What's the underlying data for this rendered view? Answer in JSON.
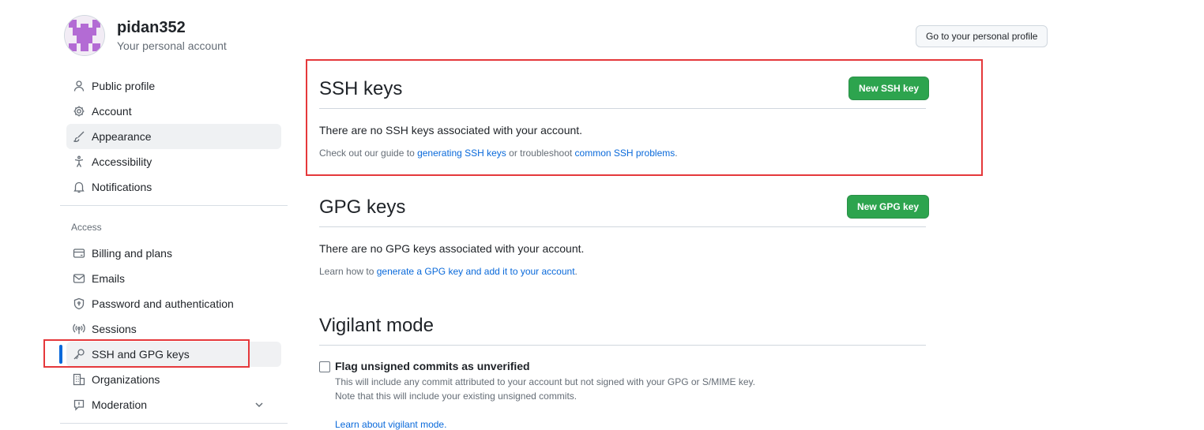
{
  "user": {
    "name": "pidan352",
    "subtitle": "Your personal account"
  },
  "header": {
    "profile_button": "Go to your personal profile"
  },
  "sidebar": {
    "items": [
      {
        "label": "Public profile",
        "icon": "person-icon"
      },
      {
        "label": "Account",
        "icon": "gear-icon"
      },
      {
        "label": "Appearance",
        "icon": "paintbrush-icon"
      },
      {
        "label": "Accessibility",
        "icon": "accessibility-icon"
      },
      {
        "label": "Notifications",
        "icon": "bell-icon"
      }
    ],
    "access_label": "Access",
    "access_items": [
      {
        "label": "Billing and plans",
        "icon": "credit-card-icon"
      },
      {
        "label": "Emails",
        "icon": "mail-icon"
      },
      {
        "label": "Password and authentication",
        "icon": "shield-lock-icon"
      },
      {
        "label": "Sessions",
        "icon": "broadcast-icon"
      },
      {
        "label": "SSH and GPG keys",
        "icon": "key-icon",
        "selected": true
      },
      {
        "label": "Organizations",
        "icon": "organization-icon"
      },
      {
        "label": "Moderation",
        "icon": "report-icon"
      }
    ]
  },
  "ssh": {
    "title": "SSH keys",
    "new_button": "New SSH key",
    "empty_text": "There are no SSH keys associated with your account.",
    "help_prefix": "Check out our guide to ",
    "help_link1": "generating SSH keys",
    "help_middle": " or troubleshoot ",
    "help_link2": "common SSH problems",
    "help_suffix": "."
  },
  "gpg": {
    "title": "GPG keys",
    "new_button": "New GPG key",
    "empty_text": "There are no GPG keys associated with your account.",
    "help_prefix": "Learn how to ",
    "help_link": "generate a GPG key and add it to your account",
    "help_suffix": "."
  },
  "vigilant": {
    "title": "Vigilant mode",
    "checkbox_label": "Flag unsigned commits as unverified",
    "desc_line1": "This will include any commit attributed to your account but not signed with your GPG or S/MIME key.",
    "desc_line2": "Note that this will include your existing unsigned commits.",
    "learn_link": "Learn about vigilant mode."
  },
  "colors": {
    "accent": "#0969da",
    "primary_button": "#2da44e",
    "annotation_red": "#e5383b"
  }
}
